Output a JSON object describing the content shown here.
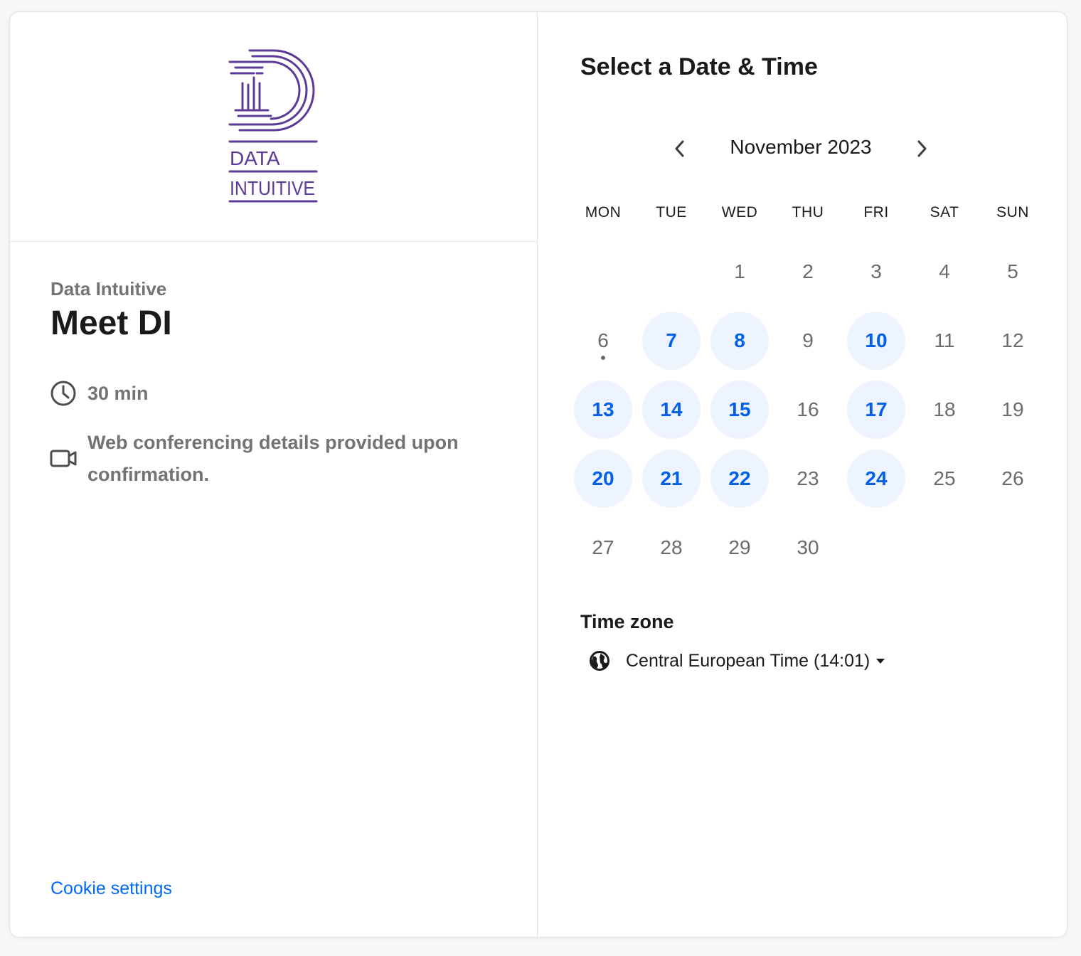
{
  "org": {
    "logo_line1": "DATA",
    "logo_line2": "INTUITIVE",
    "name": "Data Intuitive"
  },
  "event": {
    "title": "Meet DI",
    "duration": "30 min",
    "conferencing": "Web conferencing details provided upon confirmation."
  },
  "footer": {
    "cookie_settings": "Cookie settings"
  },
  "calendar": {
    "heading": "Select a Date & Time",
    "month_label": "November 2023",
    "weekdays": [
      "MON",
      "TUE",
      "WED",
      "THU",
      "FRI",
      "SAT",
      "SUN"
    ],
    "first_weekday_index": 2,
    "days_in_month": 30,
    "available_days": [
      7,
      8,
      10,
      13,
      14,
      15,
      17,
      20,
      21,
      22,
      24
    ],
    "today": 6
  },
  "timezone": {
    "label": "Time zone",
    "value": "Central European Time (14:01)"
  },
  "colors": {
    "accent": "#0069ff",
    "available_bg": "#eef4ff",
    "brand_purple": "#5b3a9a"
  },
  "icons": {
    "duration": "clock-icon",
    "conferencing": "video-camera-icon",
    "timezone": "globe-icon",
    "prev": "chevron-left-icon",
    "next": "chevron-right-icon",
    "dropdown": "caret-down-icon"
  }
}
